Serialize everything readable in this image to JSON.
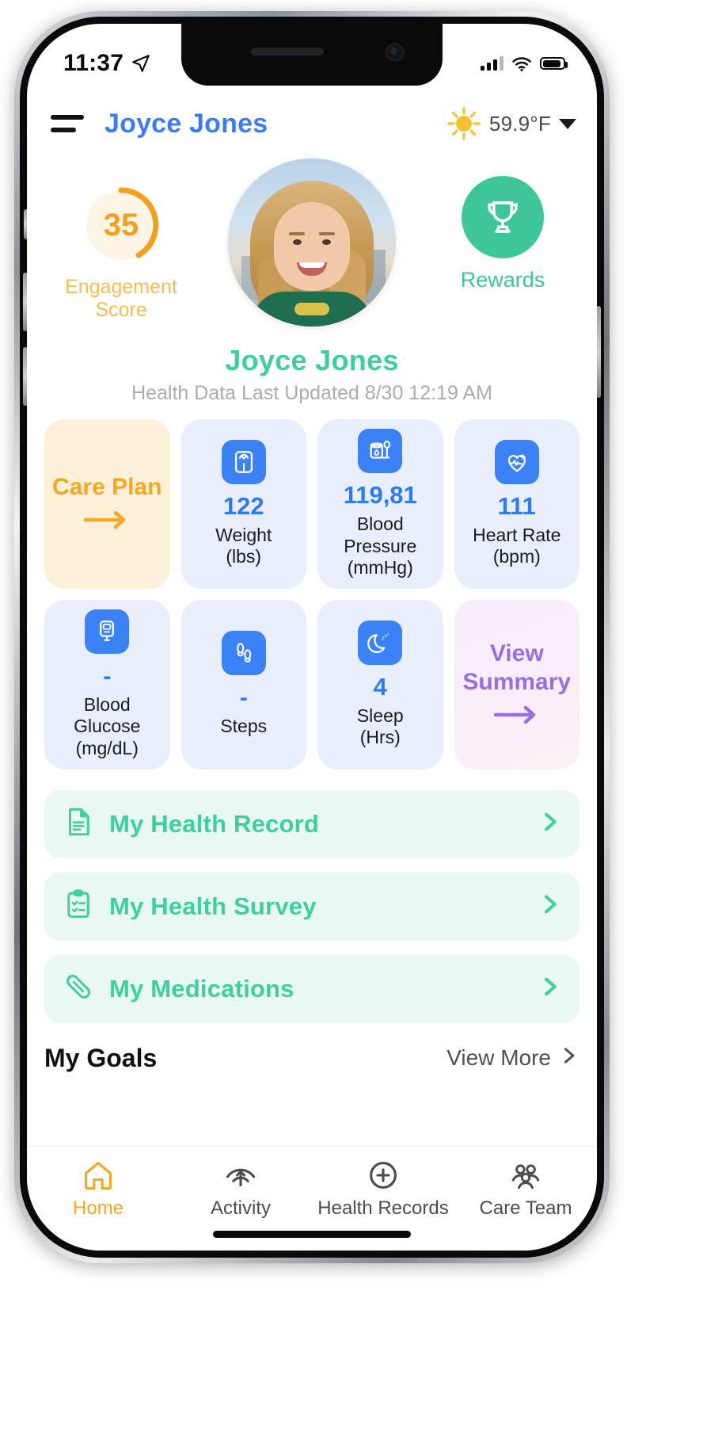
{
  "status_bar": {
    "time": "11:37",
    "location_icon": "location-arrow-icon",
    "signal_icon": "cellular-signal-icon",
    "wifi_icon": "wifi-icon",
    "battery_icon": "battery-icon"
  },
  "header": {
    "menu_icon": "hamburger-menu-icon",
    "user_name": "Joyce Jones",
    "weather_icon": "sun-icon",
    "temperature": "59.9°F",
    "chevron_icon": "chevron-down-icon"
  },
  "hero": {
    "engagement_score": "35",
    "engagement_label": "Engagement Score",
    "engagement_percent": 35,
    "avatar_alt": "profile-photo",
    "rewards_icon": "trophy-icon",
    "rewards_label": "Rewards",
    "name": "Joyce Jones",
    "last_updated": "Health Data Last Updated 8/30 12:19 AM"
  },
  "tiles": [
    {
      "kind": "care",
      "title": "Care Plan",
      "arrow_icon": "arrow-right-icon"
    },
    {
      "kind": "metric",
      "icon": "weight-scale-icon",
      "value": "122",
      "label": "Weight\n(lbs)",
      "label_line1": "Weight",
      "label_line2": "(lbs)"
    },
    {
      "kind": "metric",
      "icon": "blood-pressure-cuff-icon",
      "value": "119,81",
      "label_line1": "Blood Pressure",
      "label_line2": "(mmHg)"
    },
    {
      "kind": "metric",
      "icon": "heart-rate-icon",
      "value": "111",
      "label_line1": "Heart Rate",
      "label_line2": "(bpm)"
    },
    {
      "kind": "metric",
      "icon": "glucose-meter-icon",
      "value": "-",
      "label_line1": "Blood Glucose",
      "label_line2": "(mg/dL)"
    },
    {
      "kind": "metric",
      "icon": "footsteps-icon",
      "value": "-",
      "label_line1": "Steps",
      "label_line2": ""
    },
    {
      "kind": "metric",
      "icon": "sleep-moon-icon",
      "value": "4",
      "label_line1": "Sleep",
      "label_line2": "(Hrs)"
    },
    {
      "kind": "summary",
      "title": "View Summary",
      "arrow_icon": "arrow-right-icon"
    }
  ],
  "rows": [
    {
      "icon": "health-record-document-icon",
      "label": "My Health Record",
      "chevron": "chevron-right-icon"
    },
    {
      "icon": "clipboard-survey-icon",
      "label": "My Health Survey",
      "chevron": "chevron-right-icon"
    },
    {
      "icon": "pill-capsule-icon",
      "label": "My Medications",
      "chevron": "chevron-right-icon"
    }
  ],
  "goals": {
    "title": "My Goals",
    "view_more": "View More",
    "chevron": "chevron-right-icon"
  },
  "tabs": [
    {
      "icon": "home-icon",
      "label": "Home",
      "active": true
    },
    {
      "icon": "activity-icon",
      "label": "Activity",
      "active": false
    },
    {
      "icon": "health-records-icon",
      "label": "Health Records",
      "active": false
    },
    {
      "icon": "care-team-icon",
      "label": "Care Team",
      "active": false
    }
  ],
  "colors": {
    "accent_blue": "#3b7cf0",
    "accent_green": "#3ecf9e",
    "accent_orange": "#f5a623",
    "accent_purple": "#9b6ede",
    "tile_blue_bg": "#e8eefb",
    "tile_orange_bg": "#fdf0d9"
  }
}
